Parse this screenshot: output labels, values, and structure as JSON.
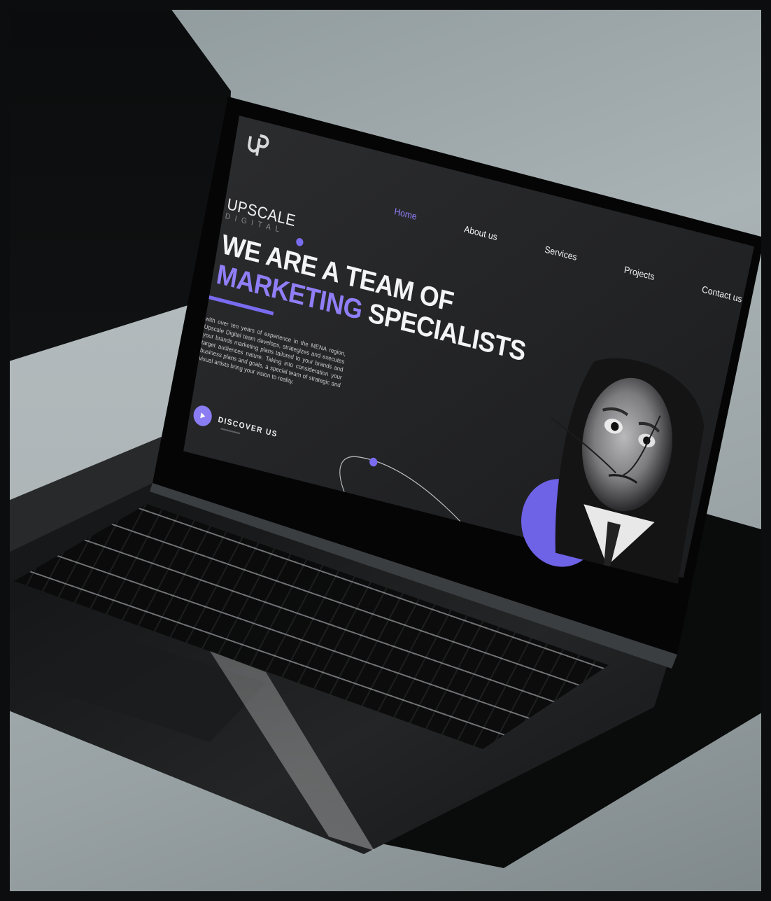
{
  "brand": {
    "logo_mark": "UP",
    "name": "UPSCALE",
    "subname": "DIGITAL"
  },
  "nav": {
    "items": [
      {
        "label": "Home",
        "active": true
      },
      {
        "label": "About us",
        "active": false
      },
      {
        "label": "Services",
        "active": false
      },
      {
        "label": "Projects",
        "active": false
      },
      {
        "label": "Contact us",
        "active": false
      }
    ]
  },
  "hero": {
    "line1": "WE ARE A TEAM OF",
    "line2_accent": "MARKETING",
    "line2_rest": "SPECIALISTS",
    "paragraph": "with over ten years of experience in the MENA region, Upscale Digital team develops, strategizes and executes your brands marketing plans tailored to your brands and target audiences nature. Taking into consideration your business plans and goals, a special team of strategic and visual artists bring your vision to reality.",
    "cta_label": "DISCOVER US"
  },
  "icons": {
    "logo": "up-logo-icon",
    "cta": "play-icon",
    "decor": "orbit-line-icon"
  },
  "colors": {
    "accent": "#8f7ff7",
    "accent_dark": "#6e62e6",
    "screen_bg": "#242527"
  }
}
